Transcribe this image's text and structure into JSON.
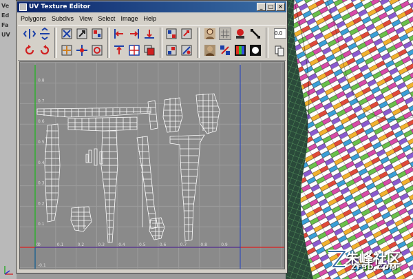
{
  "window": {
    "title": "UV Texture Editor",
    "controls": [
      "_",
      "□",
      "×"
    ]
  },
  "menu": [
    "Polygons",
    "Subdivs",
    "View",
    "Select",
    "Image",
    "Help"
  ],
  "toolbar": {
    "field_value": "0.0"
  },
  "uv_grid": {
    "y_tick_labels": [
      "0.9",
      "0.8",
      "0.7",
      "0.6",
      "0.5",
      "0.4",
      "0.3",
      "0.2",
      "0.1",
      "0",
      "-0.1"
    ],
    "x_tick_labels": [
      "0",
      "0.1",
      "0.2",
      "0.3",
      "0.4",
      "0.5",
      "0.6",
      "0.7",
      "0.8",
      "0.9"
    ]
  },
  "maya_left_strip": [
    "Ve",
    "Ed",
    "Fa",
    "UV"
  ],
  "watermark": {
    "brand": "朱峰社区",
    "url": "ZF3D.COM"
  },
  "colors": {
    "title_start": "#0a246a",
    "title_end": "#3a6ea5",
    "grid_bg": "#8a8a8a",
    "u_axis": "#d03030",
    "v_axis": "#30b030",
    "uv_wire": "#ffffff"
  }
}
